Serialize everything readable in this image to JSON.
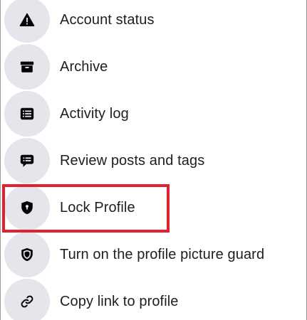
{
  "menu": {
    "items": [
      {
        "label": "Account status",
        "icon": "warning-triangle-icon"
      },
      {
        "label": "Archive",
        "icon": "archive-box-icon"
      },
      {
        "label": "Activity log",
        "icon": "activity-list-icon"
      },
      {
        "label": "Review posts and tags",
        "icon": "chat-bubble-icon"
      },
      {
        "label": "Lock Profile",
        "icon": "lock-shield-icon",
        "highlighted": true
      },
      {
        "label": "Turn on the profile picture guard",
        "icon": "shield-icon"
      },
      {
        "label": "Copy link to profile",
        "icon": "link-chain-icon"
      }
    ]
  },
  "colors": {
    "icon_circle": "#e4e6eb",
    "icon_fill": "#050505",
    "text": "#1c1e21",
    "highlight_border": "#e0222e"
  }
}
